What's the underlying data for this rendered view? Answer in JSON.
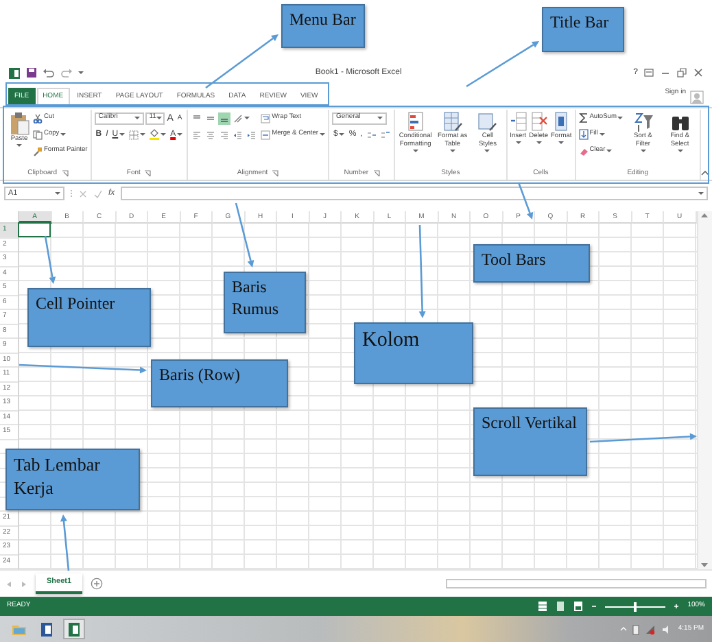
{
  "window": {
    "title": "Book1 - Microsoft Excel",
    "help": "?",
    "sign_in": "Sign in"
  },
  "menu_tabs": [
    {
      "label": "FILE",
      "kind": "file",
      "selected": false
    },
    {
      "label": "HOME",
      "kind": "tab",
      "selected": true
    },
    {
      "label": "INSERT",
      "kind": "tab",
      "selected": false
    },
    {
      "label": "PAGE LAYOUT",
      "kind": "tab",
      "selected": false
    },
    {
      "label": "FORMULAS",
      "kind": "tab",
      "selected": false
    },
    {
      "label": "DATA",
      "kind": "tab",
      "selected": false
    },
    {
      "label": "REVIEW",
      "kind": "tab",
      "selected": false
    },
    {
      "label": "VIEW",
      "kind": "tab",
      "selected": false
    }
  ],
  "ribbon": {
    "groups": [
      {
        "label": "Clipboard",
        "launcher": true,
        "parts": [
          {
            "kind": "big",
            "label": "Paste",
            "dropdown": true
          },
          {
            "kind": "stack",
            "lines": [
              [
                {
                  "kind": "small",
                  "label": "Cut",
                  "dropdown": false
                }
              ],
              [
                {
                  "kind": "small",
                  "label": "Copy",
                  "dropdown": true
                }
              ],
              [
                {
                  "kind": "small",
                  "label": "Format Painter",
                  "dropdown": false
                }
              ]
            ]
          }
        ]
      },
      {
        "label": "Font",
        "launcher": true,
        "parts": [
          {
            "kind": "stack",
            "lines": [
              [
                {
                  "kind": "field",
                  "value": "Calibri"
                },
                {
                  "kind": "field",
                  "value": "11"
                },
                {
                  "kind": "tool",
                  "glyph": "A",
                  "dropdown": false
                },
                {
                  "kind": "tool",
                  "glyph": "A",
                  "dropdown": false
                }
              ],
              [
                {
                  "kind": "tool",
                  "glyph": "B",
                  "dropdown": false
                },
                {
                  "kind": "tool",
                  "glyph": "I",
                  "dropdown": false
                },
                {
                  "kind": "tool",
                  "glyph": "U",
                  "dropdown": true
                },
                {
                  "kind": "tool",
                  "dropdown": true
                },
                {
                  "kind": "tool",
                  "dropdown": true
                },
                {
                  "kind": "tool",
                  "glyph": "A",
                  "dropdown": true
                }
              ]
            ]
          }
        ]
      },
      {
        "label": "Alignment",
        "launcher": true,
        "parts": [
          {
            "kind": "stack",
            "lines": [
              [
                {
                  "kind": "tool",
                  "dropdown": false,
                  "on": false
                },
                {
                  "kind": "tool",
                  "dropdown": false,
                  "on": false
                },
                {
                  "kind": "tool",
                  "dropdown": false,
                  "on": true
                },
                {
                  "kind": "tool",
                  "dropdown": true,
                  "on": false
                }
              ],
              [
                {
                  "kind": "tool",
                  "dropdown": false,
                  "on": false
                },
                {
                  "kind": "tool",
                  "dropdown": false,
                  "on": false
                },
                {
                  "kind": "tool",
                  "dropdown": false,
                  "on": false
                },
                {
                  "kind": "tool",
                  "dropdown": false,
                  "on": false
                },
                {
                  "kind": "tool",
                  "dropdown": false,
                  "on": false
                }
              ]
            ]
          },
          {
            "kind": "stack",
            "lines": [
              [
                {
                  "kind": "small",
                  "label": "Wrap Text",
                  "dropdown": false
                }
              ],
              [
                {
                  "kind": "small",
                  "label": "Merge & Center",
                  "dropdown": true
                }
              ]
            ]
          }
        ]
      },
      {
        "label": "Number",
        "launcher": true,
        "parts": [
          {
            "kind": "stack",
            "lines": [
              [
                {
                  "kind": "field",
                  "value": "General"
                }
              ],
              [
                {
                  "kind": "tool",
                  "glyph": "$",
                  "dropdown": true
                },
                {
                  "kind": "tool",
                  "glyph": "%",
                  "dropdown": false
                },
                {
                  "kind": "tool",
                  "glyph": ",",
                  "dropdown": false
                },
                {
                  "kind": "tool",
                  "dropdown": false
                },
                {
                  "kind": "tool",
                  "dropdown": false
                }
              ]
            ]
          }
        ]
      },
      {
        "label": "Styles",
        "launcher": false,
        "parts": [
          {
            "kind": "big",
            "label": "Conditional Formatting",
            "dropdown": true
          },
          {
            "kind": "big",
            "label": "Format as Table",
            "dropdown": true
          },
          {
            "kind": "big",
            "label": "Cell Styles",
            "dropdown": true
          }
        ]
      },
      {
        "label": "Cells",
        "launcher": false,
        "parts": [
          {
            "kind": "big",
            "label": "Insert",
            "dropdown": true
          },
          {
            "kind": "big",
            "label": "Delete",
            "dropdown": true
          },
          {
            "kind": "big",
            "label": "Format",
            "dropdown": true
          }
        ]
      },
      {
        "label": "Editing",
        "launcher": false,
        "parts": [
          {
            "kind": "stack",
            "lines": [
              [
                {
                  "kind": "small",
                  "label": "AutoSum",
                  "dropdown": true
                }
              ],
              [
                {
                  "kind": "small",
                  "label": "Fill",
                  "dropdown": true
                }
              ],
              [
                {
                  "kind": "small",
                  "label": "Clear",
                  "dropdown": true
                }
              ]
            ]
          },
          {
            "kind": "big",
            "label": "Sort & Filter",
            "dropdown": true
          },
          {
            "kind": "big",
            "label": "Find & Select",
            "dropdown": true
          }
        ]
      }
    ]
  },
  "formula_bar": {
    "name_box": "A1",
    "fx": "fx"
  },
  "columns": [
    {
      "label": "A",
      "selected": true
    },
    {
      "label": "B",
      "selected": false
    },
    {
      "label": "C",
      "selected": false
    },
    {
      "label": "D",
      "selected": false
    },
    {
      "label": "E",
      "selected": false
    },
    {
      "label": "F",
      "selected": false
    },
    {
      "label": "G",
      "selected": false
    },
    {
      "label": "H",
      "selected": false
    },
    {
      "label": "I",
      "selected": false
    },
    {
      "label": "J",
      "selected": false
    },
    {
      "label": "K",
      "selected": false
    },
    {
      "label": "L",
      "selected": false
    },
    {
      "label": "M",
      "selected": false
    },
    {
      "label": "N",
      "selected": false
    },
    {
      "label": "O",
      "selected": false
    },
    {
      "label": "P",
      "selected": false
    },
    {
      "label": "Q",
      "selected": false
    },
    {
      "label": "R",
      "selected": false
    },
    {
      "label": "S",
      "selected": false
    },
    {
      "label": "T",
      "selected": false
    },
    {
      "label": "U",
      "selected": false
    }
  ],
  "rows": [
    {
      "label": "1",
      "selected": true
    },
    {
      "label": "2",
      "selected": false
    },
    {
      "label": "3",
      "selected": false
    },
    {
      "label": "4",
      "selected": false
    },
    {
      "label": "5",
      "selected": false
    },
    {
      "label": "6",
      "selected": false
    },
    {
      "label": "7",
      "selected": false
    },
    {
      "label": "8",
      "selected": false
    },
    {
      "label": "9",
      "selected": false
    },
    {
      "label": "10",
      "selected": false
    },
    {
      "label": "11",
      "selected": false
    },
    {
      "label": "12",
      "selected": false
    },
    {
      "label": "13",
      "selected": false
    },
    {
      "label": "14",
      "selected": false
    },
    {
      "label": "15",
      "selected": false
    },
    {
      "selected": false
    },
    {
      "selected": false
    },
    {
      "selected": false
    },
    {
      "selected": false
    },
    {
      "selected": false
    },
    {
      "label": "21",
      "selected": false
    },
    {
      "label": "22",
      "selected": false
    },
    {
      "label": "23",
      "selected": false
    },
    {
      "label": "24",
      "selected": false
    }
  ],
  "sheet_tabs": [
    {
      "label": "Sheet1",
      "selected": true
    }
  ],
  "status_bar": {
    "mode": "READY",
    "zoom": {
      "level": 0.5,
      "reading": "100%"
    }
  },
  "taskbar": {
    "apps": [
      {
        "selected": false
      },
      {
        "selected": false
      },
      {
        "selected": true
      }
    ],
    "time": "4:15 PM"
  },
  "callouts": [
    {
      "label": "Menu Bar"
    },
    {
      "label": "Title Bar"
    },
    {
      "label": "Tool Bars"
    },
    {
      "label": "Baris Rumus"
    },
    {
      "label": "Cell Pointer"
    },
    {
      "label": "Kolom"
    },
    {
      "label": "Baris (Row)"
    },
    {
      "label": "Scroll Vertikal"
    },
    {
      "label": "Tab Lembar Kerja"
    }
  ]
}
